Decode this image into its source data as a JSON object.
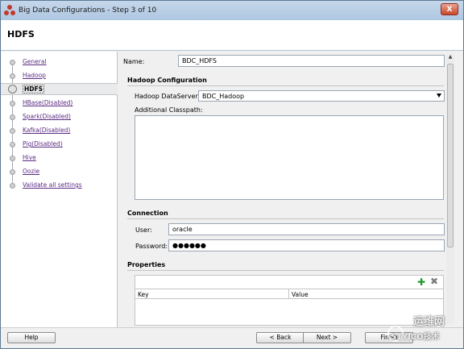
{
  "window": {
    "title": "Big Data Configurations - Step 3 of 10",
    "close_label": "X"
  },
  "header": {
    "title": "HDFS"
  },
  "nav": {
    "items": [
      {
        "label": "General"
      },
      {
        "label": "Hadoop"
      },
      {
        "label": "HDFS"
      },
      {
        "label": "HBase(Disabled)"
      },
      {
        "label": "Spark(Disabled)"
      },
      {
        "label": "Kafka(Disabled)"
      },
      {
        "label": "Pig(Disabled)"
      },
      {
        "label": "Hive"
      },
      {
        "label": "Oozie"
      },
      {
        "label": "Validate all settings"
      }
    ]
  },
  "form": {
    "name_label": "Name:",
    "name_value": "BDC_HDFS",
    "hadoop_config_title": "Hadoop Configuration",
    "dataserver_label": "Hadoop DataServer:",
    "dataserver_value": "BDC_Hadoop",
    "classpath_label": "Additional Classpath:",
    "connection_title": "Connection",
    "user_label": "User:",
    "user_value": "oracle",
    "password_label": "Password:",
    "password_value": "●●●●●●",
    "properties_title": "Properties",
    "properties_columns": [
      "Key",
      "Value"
    ]
  },
  "footer": {
    "help": "Help",
    "back": "< Back",
    "next": "Next >",
    "finish": "Finish"
  },
  "watermark": {
    "text": "运维网",
    "sub": "51YICO技术"
  }
}
